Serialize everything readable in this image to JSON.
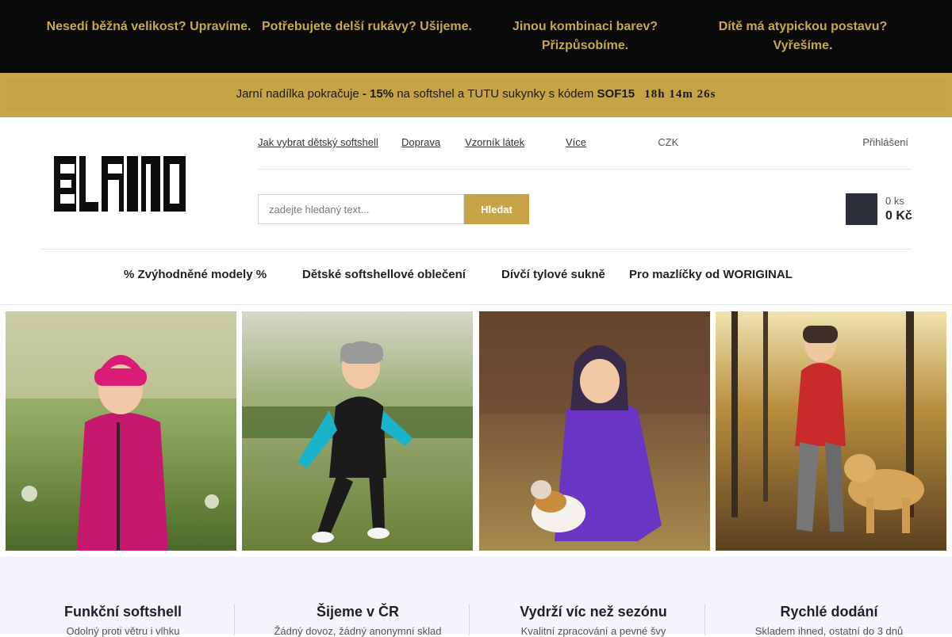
{
  "topbar": {
    "messages": [
      "Nesedí běžná velikost? Upravíme.",
      "Potřebujete delší rukávy? Ušijeme.",
      "Jinou kombinaci barev? Přizpůsobíme.",
      "Dítě má atypickou postavu? Vyřešíme."
    ]
  },
  "promo": {
    "icon": "",
    "lead": " Jarní nadílka pokračuje ",
    "discount": "- 15%",
    "mid": " na softshel a TUTU sukynky ",
    "code_prefix": " s kódem ",
    "code": "SOF15",
    "timer": "18h 14m 26s",
    "close_icon": ""
  },
  "header": {
    "logo_text": "ELFINO",
    "links": [
      "Jak vybrat dětský softshell",
      "Doprava",
      "Vzorník látek",
      "Více"
    ],
    "more_icon": "",
    "currency": "CZK",
    "currency_icon": "",
    "login": "Přihlášení",
    "login_icon": "",
    "search_placeholder": "zadejte hledaný text...",
    "search_button": "Hledat",
    "cart_icon": "",
    "cart_count": "0 ks",
    "cart_price": "0 Kč"
  },
  "nav": {
    "items": [
      {
        "label": "% Zvýhodněné modely %",
        "caret": ""
      },
      {
        "label": "Dětské softshellové oblečení",
        "caret": ""
      },
      {
        "label": "Dívčí tylové sukně",
        "caret": ""
      },
      {
        "label": "Pro mazlíčky od WORIGINAL",
        "caret": ""
      }
    ]
  },
  "features": [
    {
      "title": "Funkční softshell",
      "desc": "Odolný proti větru i vlhku"
    },
    {
      "title": "Šijeme v ČR",
      "desc": "Žádný dovoz, žádný anonymní sklad"
    },
    {
      "title": "Vydrží víc než sezónu",
      "desc": "Kvalitní zpracování a pevné švy"
    },
    {
      "title": "Rychlé dodání",
      "desc": "Skladem ihned, ostatní do 3 dnů"
    }
  ],
  "colors": {
    "gold": "#c6a445",
    "dark": "#0a0a0a",
    "cart": "#2a2f3a"
  }
}
